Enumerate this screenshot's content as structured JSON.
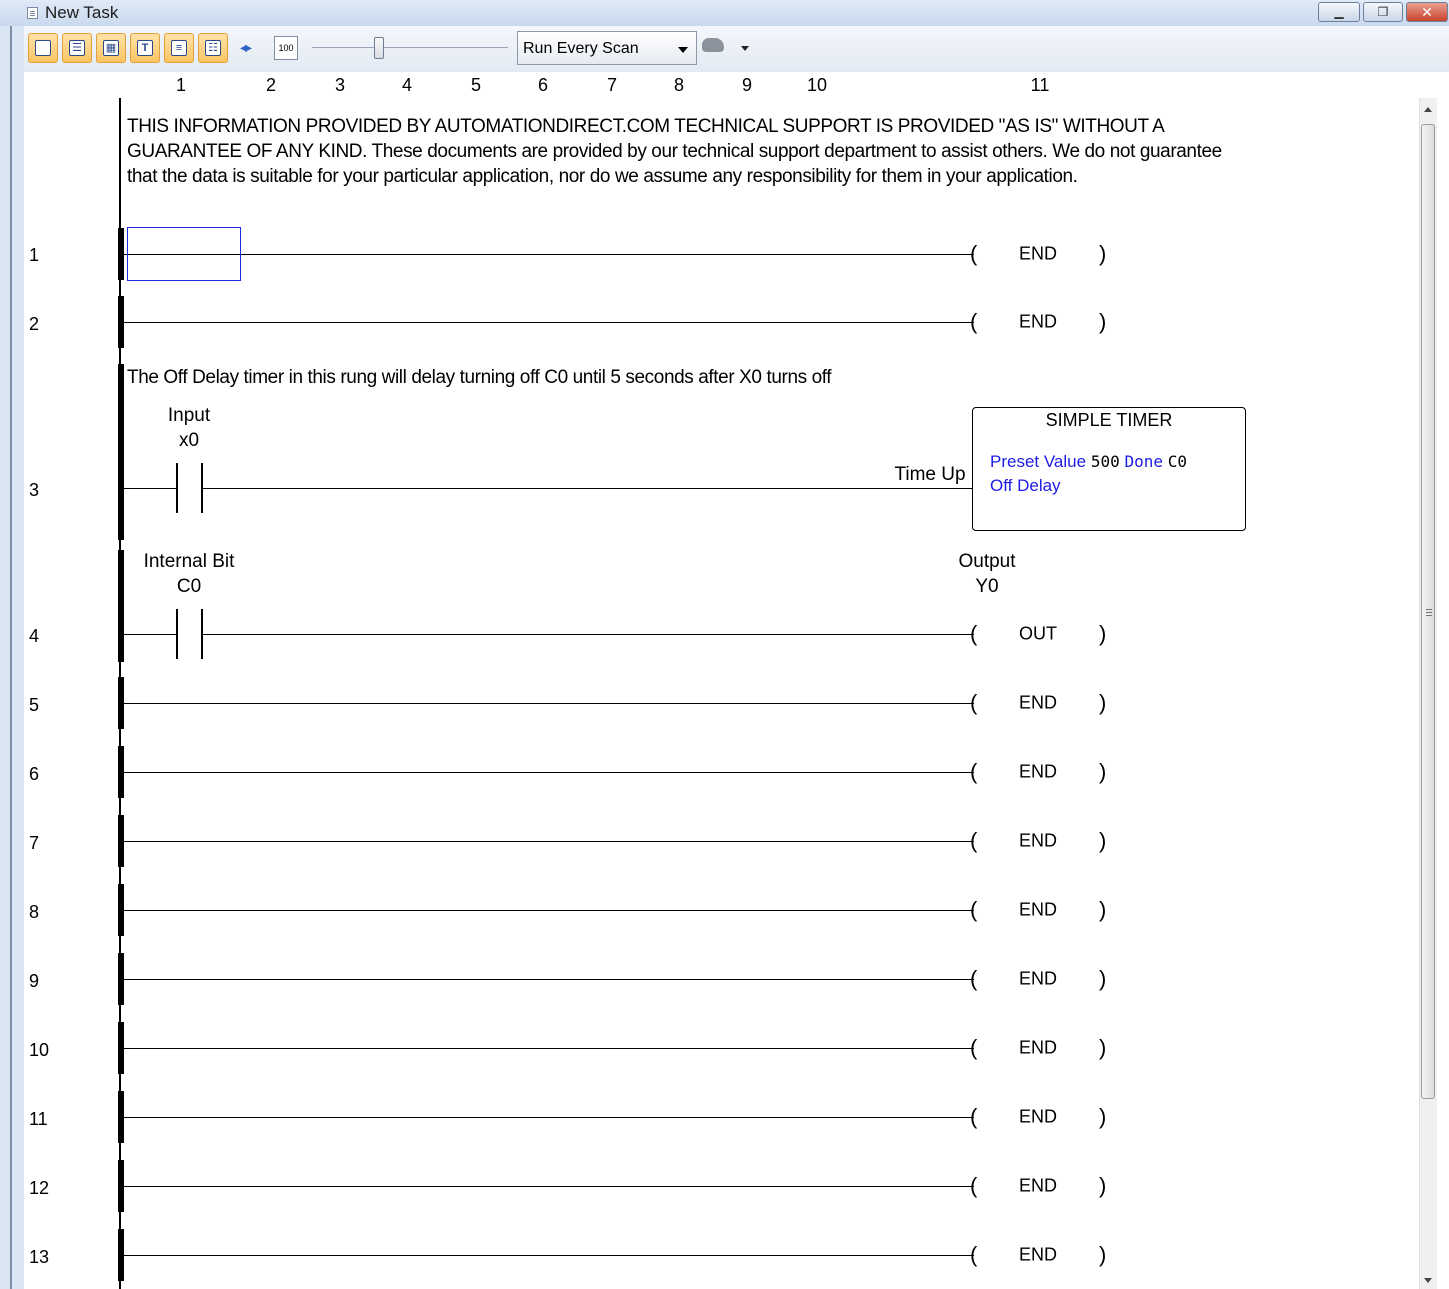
{
  "window": {
    "title": "New Task"
  },
  "toolbar": {
    "zoom_value": "100",
    "scan_mode": "Run Every Scan"
  },
  "columns": [
    "1",
    "2",
    "3",
    "4",
    "5",
    "6",
    "7",
    "8",
    "9",
    "10",
    "11"
  ],
  "comments": {
    "disclaimer": "THIS INFORMATION PROVIDED BY AUTOMATIONDIRECT.COM TECHNICAL SUPPORT IS PROVIDED \"AS IS\" WITHOUT A GUARANTEE OF ANY KIND. These documents are provided by our technical support department to assist others. We do not guarantee that the data is suitable for your particular application, nor do we assume any responsibility for them in your application.",
    "rung3": "The Off Delay timer in this rung will delay turning off C0 until 5 seconds after X0 turns off"
  },
  "rungs": [
    {
      "num": "1",
      "coil": "END"
    },
    {
      "num": "2",
      "coil": "END"
    },
    {
      "num": "3"
    },
    {
      "num": "4",
      "coil": "OUT"
    },
    {
      "num": "5",
      "coil": "END"
    },
    {
      "num": "6",
      "coil": "END"
    },
    {
      "num": "7",
      "coil": "END"
    },
    {
      "num": "8",
      "coil": "END"
    },
    {
      "num": "9",
      "coil": "END"
    },
    {
      "num": "10",
      "coil": "END"
    },
    {
      "num": "11",
      "coil": "END"
    },
    {
      "num": "12",
      "coil": "END"
    },
    {
      "num": "13",
      "coil": "END"
    }
  ],
  "rung3": {
    "contact_name": "Input",
    "contact_addr": "x0",
    "timer_label": "Time Up",
    "timer": {
      "title": "SIMPLE TIMER",
      "preset_label": "Preset Value",
      "preset_value": "500",
      "done_label": "Done",
      "done_value": "C0",
      "mode": "Off Delay"
    }
  },
  "rung4": {
    "contact_name": "Internal Bit",
    "contact_addr": "C0",
    "coil_name": "Output",
    "coil_addr": "Y0"
  }
}
